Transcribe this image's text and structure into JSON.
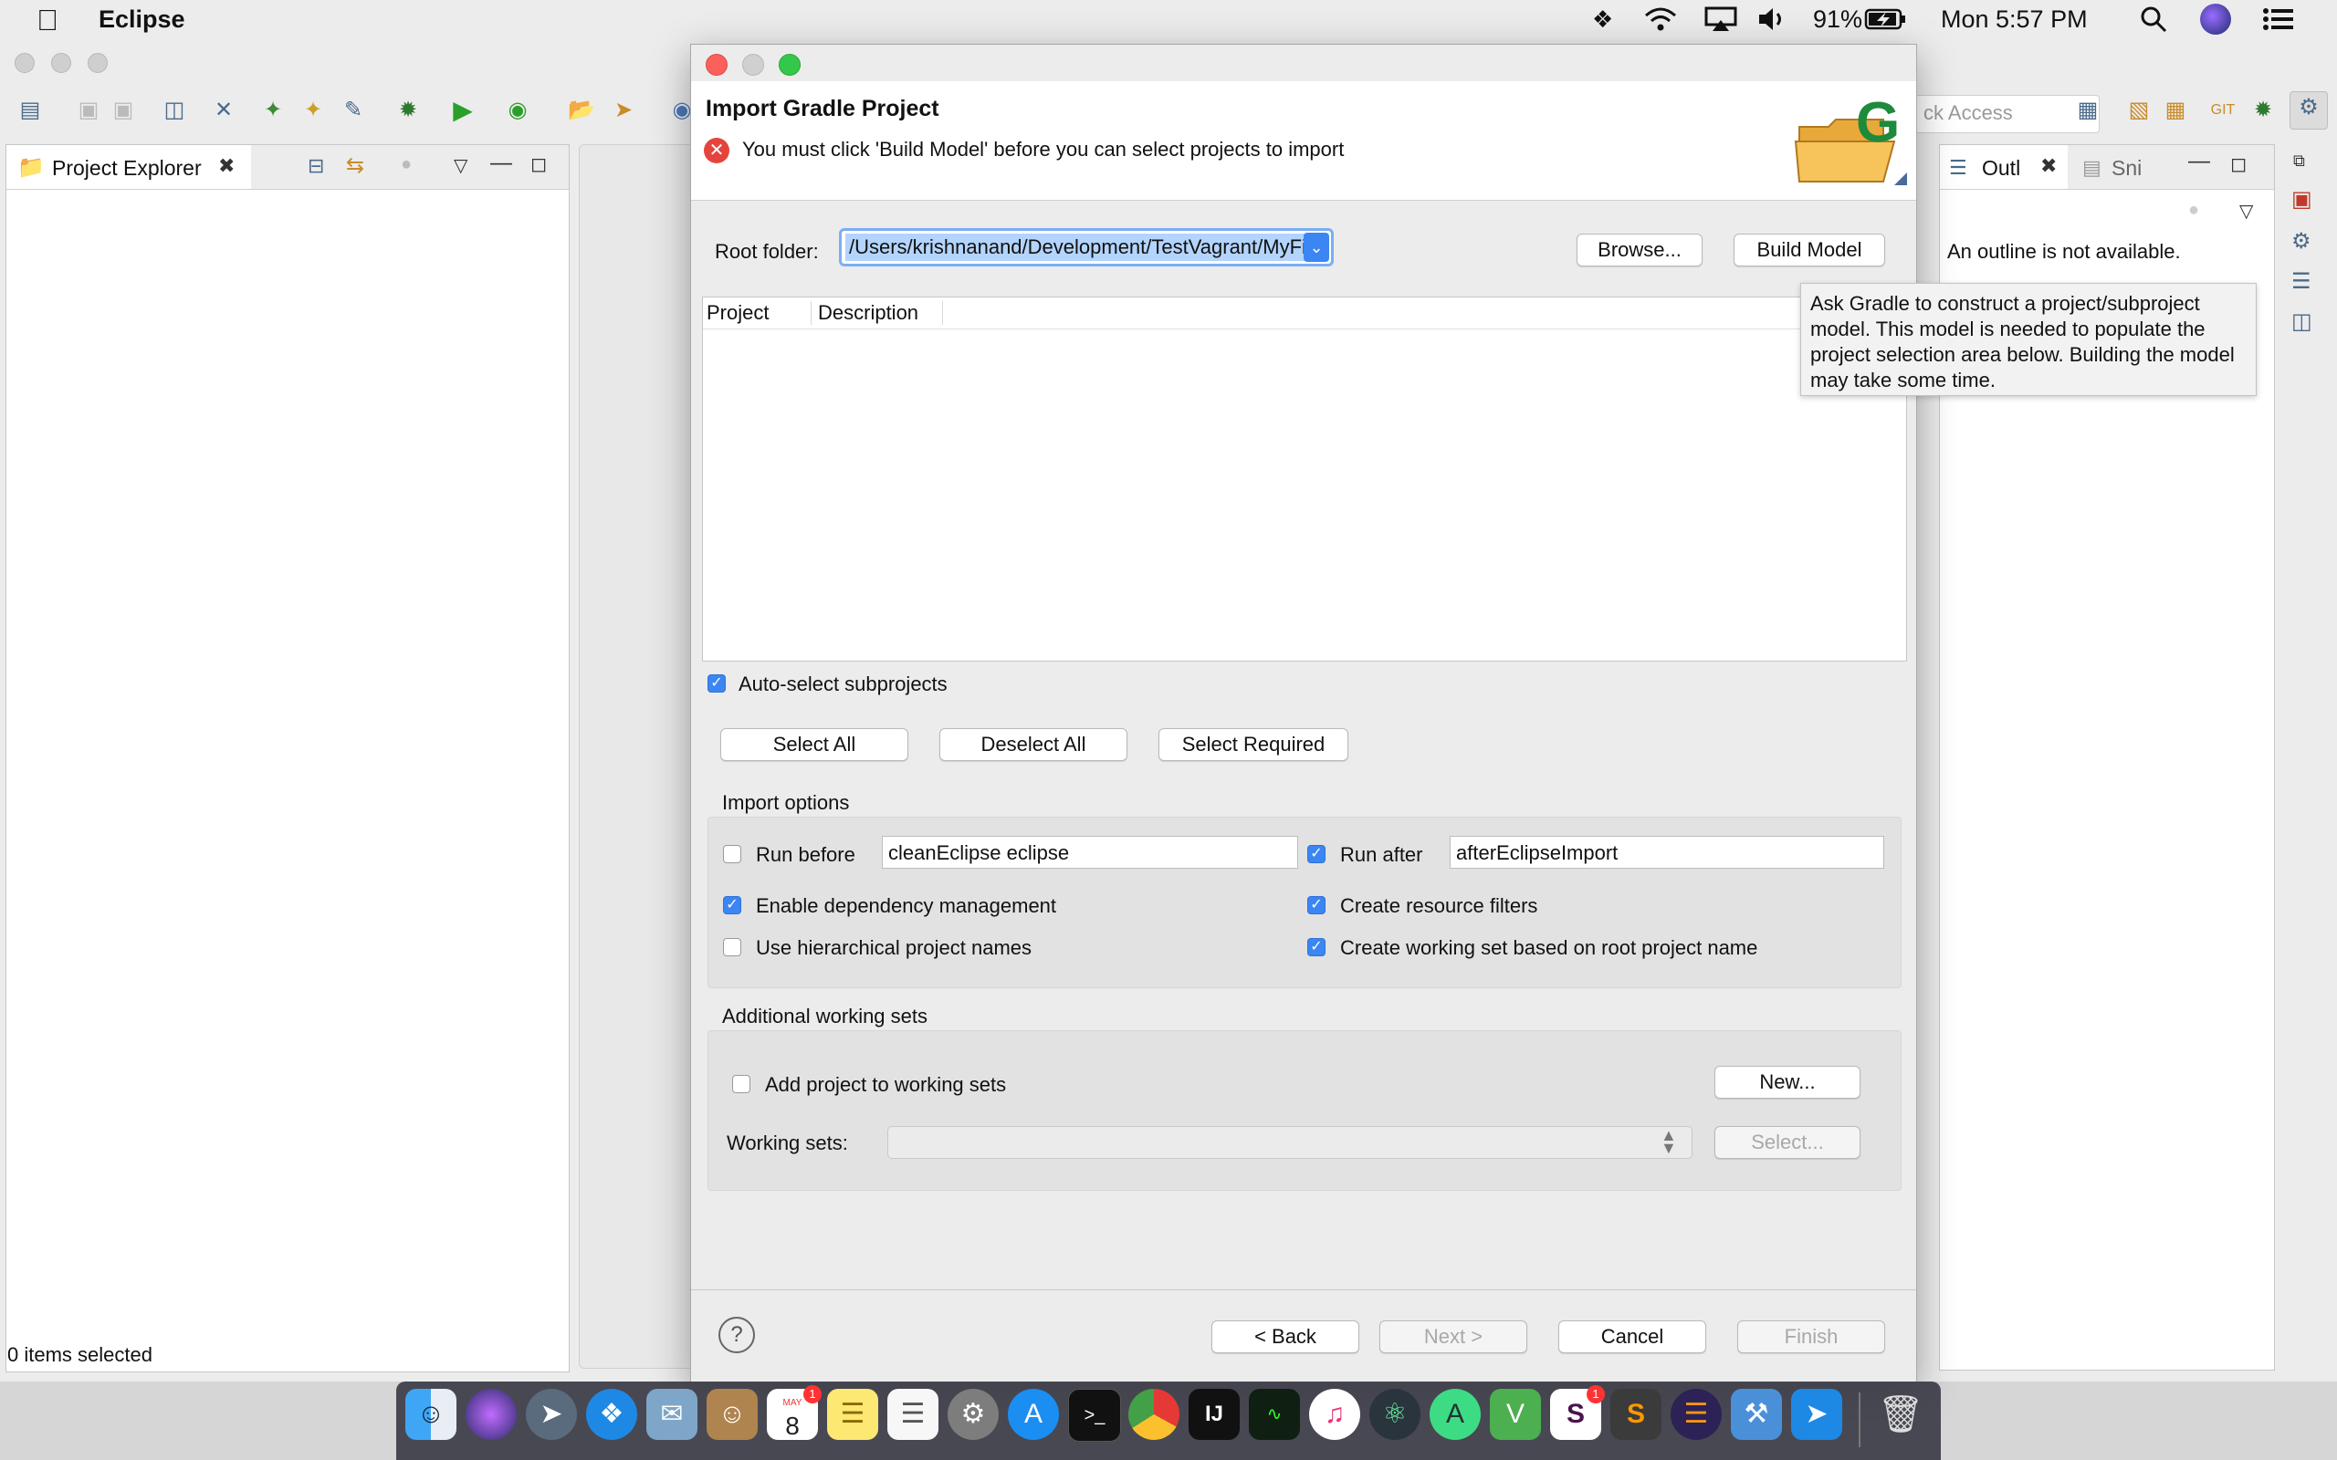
{
  "menubar": {
    "apple": "",
    "app_name": "Eclipse",
    "battery": "91%",
    "clock": "Mon 5:57 PM"
  },
  "left_panel": {
    "tab_label": "Project Explorer",
    "status": "0 items selected"
  },
  "right_panel": {
    "tab_outline": "Outl",
    "tab_snippets": "Sni",
    "quick_access": "ck Access",
    "empty_message": "An outline is not available."
  },
  "dialog": {
    "title": "Import Gradle Project",
    "message": "You must click 'Build Model' before you can select projects to import",
    "root_folder_label": "Root folder:",
    "root_folder_value": "/Users/krishnanand/Development/TestVagrant/MyFirstOptimusProject",
    "browse_button": "Browse...",
    "build_model_button": "Build Model",
    "table_headers": [
      "Project",
      "Description"
    ],
    "auto_select_label": "Auto-select subprojects",
    "auto_select_checked": true,
    "select_all": "Select All",
    "deselect_all": "Deselect All",
    "select_required": "Select Required",
    "import_options_title": "Import options",
    "run_before_label": "Run before",
    "run_before_checked": false,
    "run_before_value": "cleanEclipse eclipse",
    "run_after_label": "Run after",
    "run_after_checked": true,
    "run_after_value": "afterEclipseImport",
    "enable_dep_label": "Enable dependency management",
    "enable_dep_checked": true,
    "resource_filters_label": "Create resource filters",
    "resource_filters_checked": true,
    "hierarchical_label": "Use hierarchical project names",
    "hierarchical_checked": false,
    "working_set_root_label": "Create working set based on root project name",
    "working_set_root_checked": true,
    "additional_ws_title": "Additional working sets",
    "add_to_ws_label": "Add project to working sets",
    "add_to_ws_checked": false,
    "new_button": "New...",
    "working_sets_label": "Working sets:",
    "working_sets_value": "",
    "select_button": "Select...",
    "help_icon": "?",
    "back_button": "< Back",
    "next_button": "Next >",
    "cancel_button": "Cancel",
    "finish_button": "Finish"
  },
  "tooltip": {
    "text": "Ask Gradle to construct a project/subproject model. This model is needed to populate the project selection area below. Building the model may take some time."
  },
  "dock": {
    "calendar_month": "MAY",
    "calendar_day": "8",
    "calendar_badge": "1",
    "slack_badge": "1"
  },
  "colors": {
    "accent": "#3b86f2",
    "error": "#e5443c",
    "selection": "#b3d4fc"
  }
}
